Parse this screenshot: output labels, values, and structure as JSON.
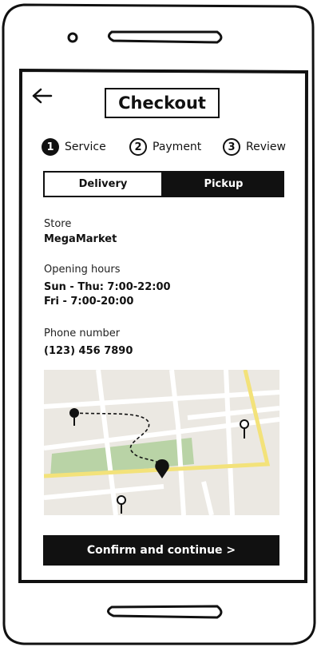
{
  "header": {
    "title": "Checkout",
    "back_icon": "arrow-left-icon"
  },
  "steps": [
    {
      "number": "1",
      "label": "Service",
      "active": true
    },
    {
      "number": "2",
      "label": "Payment",
      "active": false
    },
    {
      "number": "3",
      "label": "Review",
      "active": false
    }
  ],
  "mode_toggle": {
    "options": [
      "Delivery",
      "Pickup"
    ],
    "selected": "Pickup"
  },
  "store": {
    "label": "Store",
    "value": "MegaMarket"
  },
  "hours": {
    "label": "Opening hours",
    "lines": [
      "Sun - Thu: 7:00-22:00",
      "Fri - 7:00-20:00"
    ]
  },
  "phone": {
    "label": "Phone number",
    "value": "(123) 456 7890"
  },
  "map": {
    "colors": {
      "background": "#ebe8e2",
      "road": "#ffffff",
      "highlight_road": "#f3e27a",
      "park": "#b9d3a6",
      "route": "#111111"
    },
    "pin_icon": "map-pin-icon",
    "destination_icon": "destination-marker-icon"
  },
  "cta": {
    "label": "Confirm and continue >"
  },
  "colors": {
    "accent": "#111111",
    "background": "#ffffff"
  }
}
